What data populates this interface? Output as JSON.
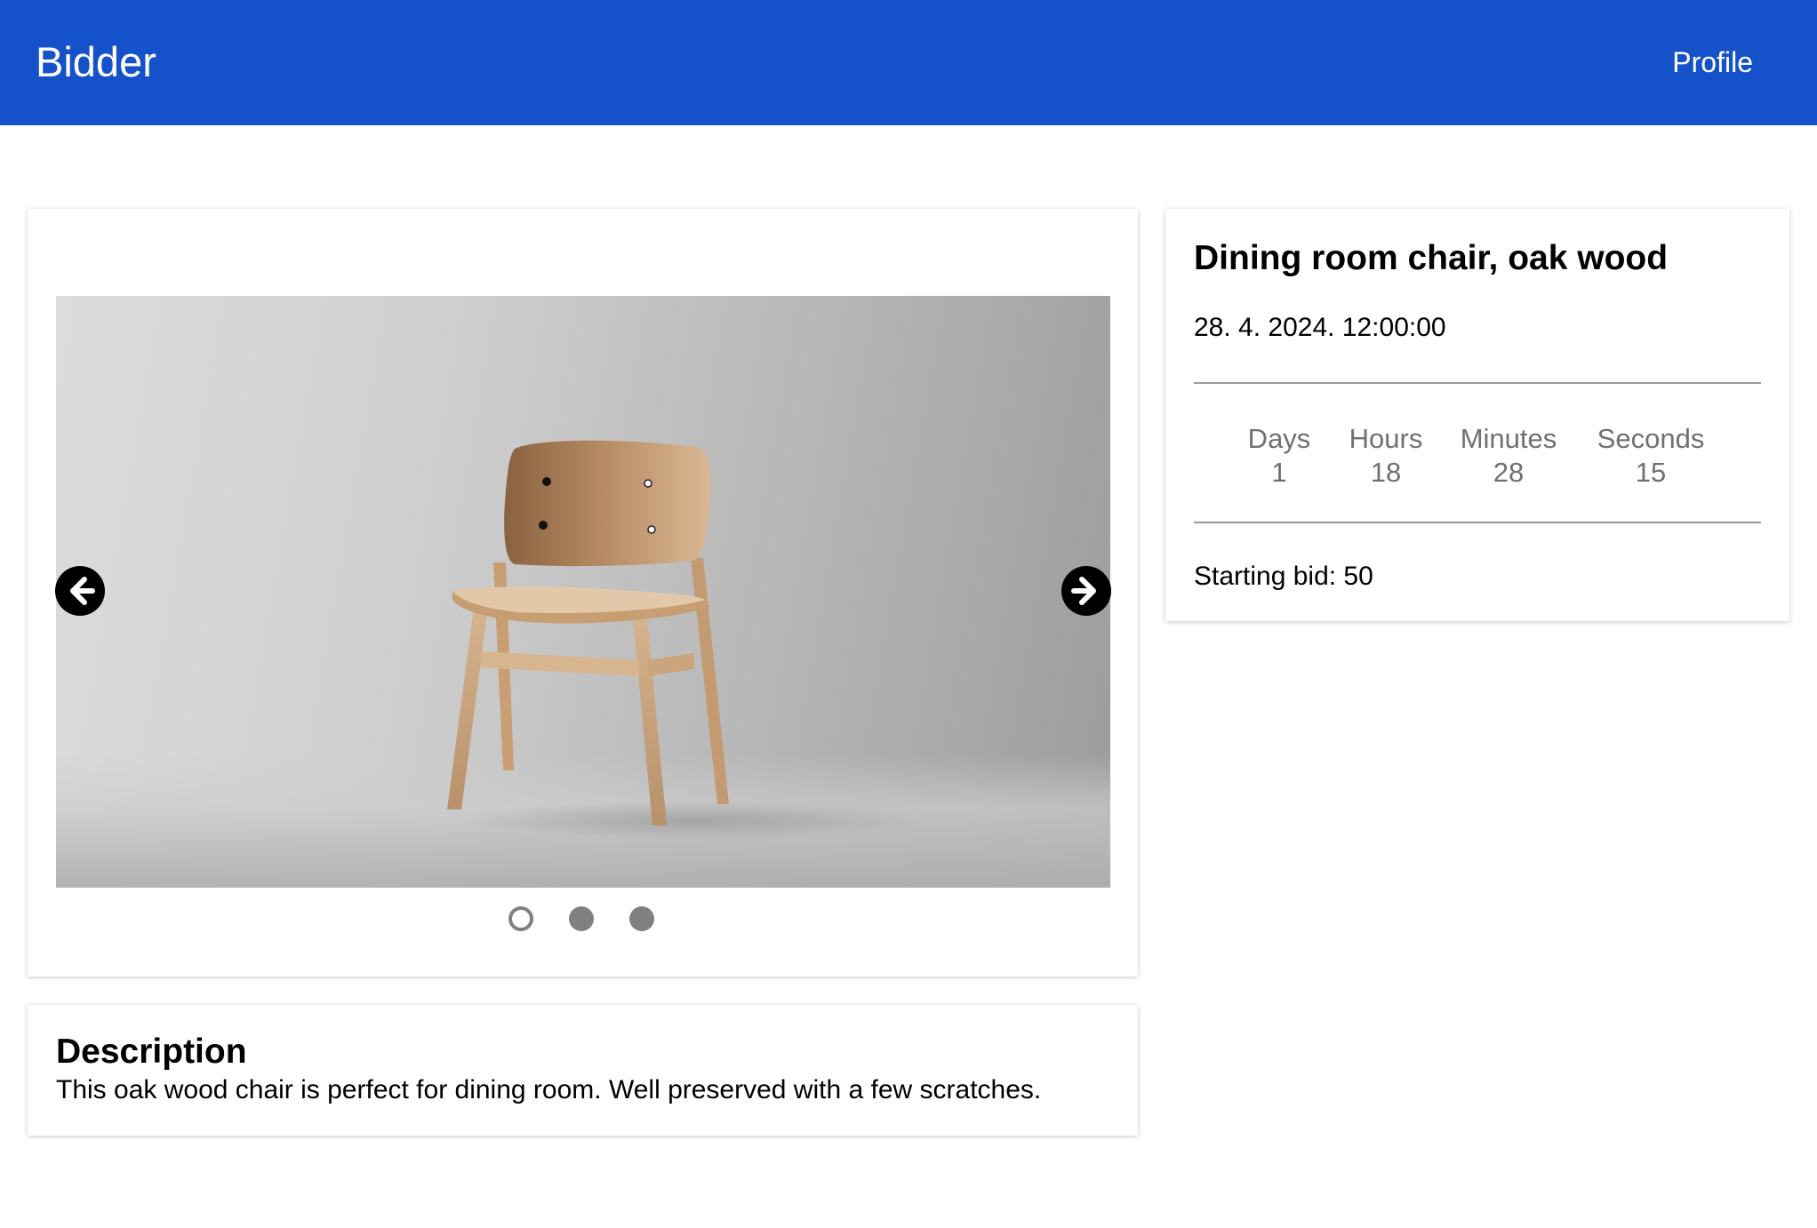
{
  "navbar": {
    "brand": "Bidder",
    "profile_label": "Profile",
    "color": "#1552c9"
  },
  "gallery": {
    "image_alt": "Oak wood dining chair",
    "prev_icon": "arrow-left-circle-icon",
    "next_icon": "arrow-right-circle-icon",
    "slide_count": 3,
    "active_slide": 1
  },
  "description": {
    "title": "Description",
    "text": "This oak wood chair is perfect for dining room. Well preserved with a few scratches."
  },
  "item": {
    "title": "Dining room chair, oak wood",
    "date": "28. 4. 2024. 12:00:00",
    "countdown": {
      "days_label": "Days",
      "days": "1",
      "hours_label": "Hours",
      "hours": "18",
      "minutes_label": "Minutes",
      "minutes": "28",
      "seconds_label": "Seconds",
      "seconds": "15"
    },
    "starting_bid": "Starting bid: 50"
  }
}
